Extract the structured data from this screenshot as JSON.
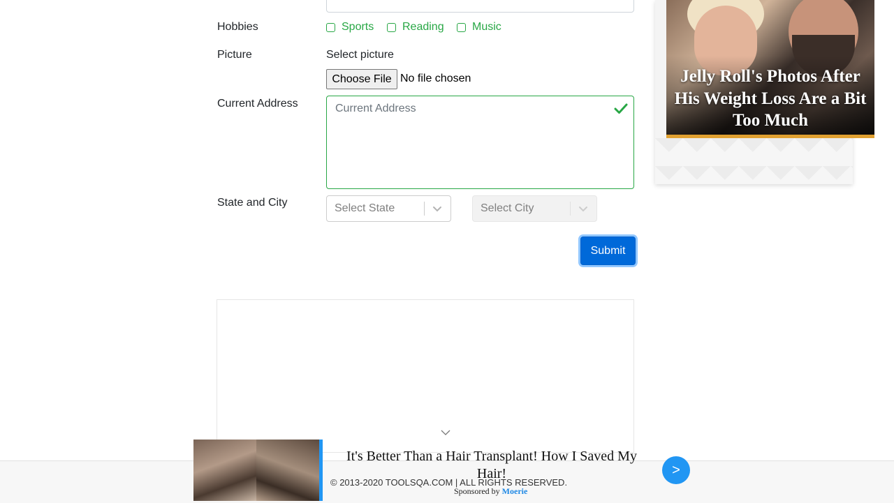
{
  "form": {
    "hobbies": {
      "label": "Hobbies",
      "options": [
        {
          "label": "Sports",
          "checked": false
        },
        {
          "label": "Reading",
          "checked": false
        },
        {
          "label": "Music",
          "checked": false
        }
      ]
    },
    "picture": {
      "label": "Picture",
      "helper": "Select picture",
      "button_label": "Choose File",
      "status": "No file chosen"
    },
    "address": {
      "label": "Current Address",
      "placeholder": "Current Address",
      "valid_icon": "check-icon"
    },
    "state_city": {
      "label": "State and City",
      "state_placeholder": "Select State",
      "city_placeholder": "Select City",
      "dropdown_icon": "chevron-down-icon"
    },
    "submit_label": "Submit"
  },
  "side_ad": {
    "headline": "Jelly Roll's Photos After His Weight Loss Are a Bit Too Much"
  },
  "bottom_ad": {
    "title": "It's Better Than a Hair Transplant! How I Saved My Hair!",
    "sponsored_prefix": "Sponsored by",
    "sponsor": "Moerie",
    "next_label": ">"
  },
  "footer": {
    "copyright": "© 2013-2020 TOOLSQA.COM | ALL RIGHTS RESERVED."
  },
  "colors": {
    "valid_green": "#28a745",
    "primary_blue": "#0069d9",
    "ad_blue": "#2196f3"
  }
}
